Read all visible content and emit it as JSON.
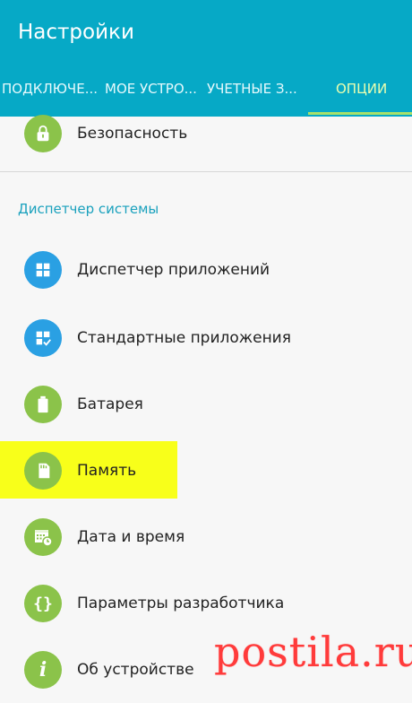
{
  "app": {
    "title": "Настройки"
  },
  "tabs": [
    {
      "label": "ПОДКЛЮЧЕ...",
      "active": false
    },
    {
      "label": "МОЕ УСТРО...",
      "active": false
    },
    {
      "label": "УЧЕТНЫЕ З...",
      "active": false
    },
    {
      "label": "ОПЦИИ",
      "active": true
    }
  ],
  "top_item": {
    "label": "Безопасность",
    "icon": "lock-icon"
  },
  "section": {
    "title": "Диспетчер системы"
  },
  "items": [
    {
      "label": "Диспетчер приложений",
      "icon": "apps-grid-icon",
      "color": "#2aa0e3"
    },
    {
      "label": "Стандартные приложения",
      "icon": "default-apps-icon",
      "color": "#2aa0e3"
    },
    {
      "label": "Батарея",
      "icon": "battery-icon",
      "color": "#8bc34a"
    },
    {
      "label": "Память",
      "icon": "sd-card-icon",
      "color": "#8bc34a",
      "highlighted": true
    },
    {
      "label": "Дата и время",
      "icon": "calendar-clock-icon",
      "color": "#8bc34a"
    },
    {
      "label": "Параметры разработчика",
      "icon": "braces-icon",
      "color": "#8bc34a"
    },
    {
      "label": "Об устройстве",
      "icon": "info-icon",
      "color": "#8bc34a"
    }
  ],
  "watermark": {
    "text": "postila.ru"
  },
  "colors": {
    "header": "#06a9c6",
    "accent_green": "#8bc34a",
    "accent_blue": "#2aa0e3",
    "highlight": "#f8ff1a",
    "section_title": "#1aa1bd"
  }
}
